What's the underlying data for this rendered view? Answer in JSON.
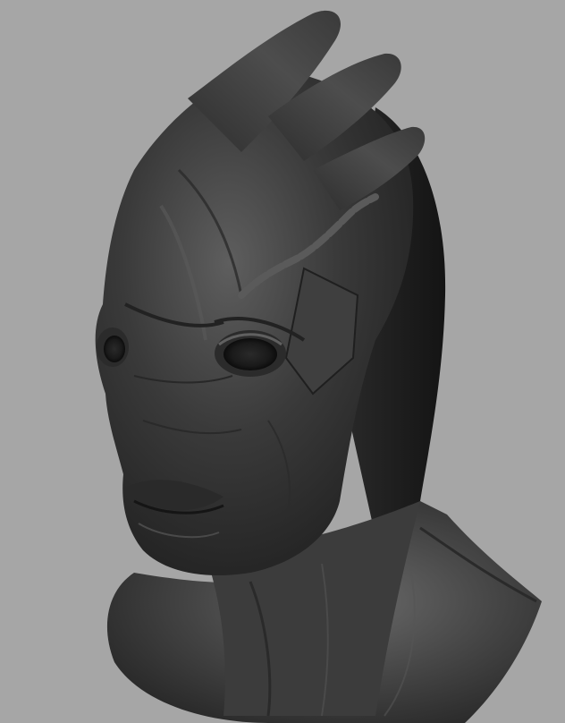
{
  "scene": {
    "subject": "alien-head-sculpt",
    "background_color": "#a6a6a6",
    "material": {
      "base": "#3b3b3b",
      "highlight": "#6e6e6e",
      "shadow": "#181818"
    }
  }
}
